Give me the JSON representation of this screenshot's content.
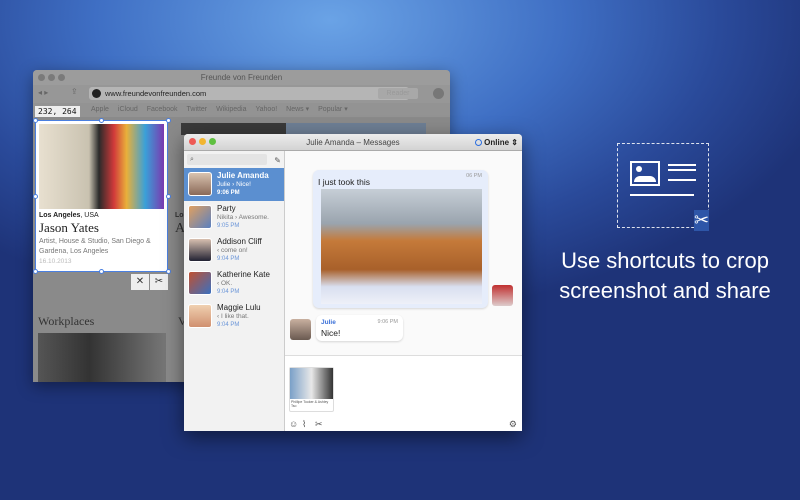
{
  "browser": {
    "title": "Freunde von Freunden",
    "url": "www.freundevonfreunden.com",
    "reader_label": "Reader",
    "bookmarks": [
      "Apple",
      "iCloud",
      "Facebook",
      "Twitter",
      "Wikipedia",
      "Yahoo!",
      "News ▾",
      "Popular ▾"
    ]
  },
  "capture": {
    "coordinates": "232, 264",
    "card": {
      "location_bold": "Los Angeles",
      "location_rest": ", USA",
      "name": "Jason Yates",
      "description": "Artist, House & Studio, San Diego & Gardena, Los Angeles",
      "date": "16.10.2013"
    },
    "close_label": "✕",
    "share_label": "✂"
  },
  "page": {
    "section_heading": "Workplaces",
    "next_heading": "V",
    "partial_label": "Lo",
    "partial_letter": "A"
  },
  "messages": {
    "title": "Julie Amanda – Messages",
    "status": "Online",
    "conversations": [
      {
        "name": "Julie Amanda",
        "preview": "Julie › Nice!",
        "time": "9:06 PM"
      },
      {
        "name": "Party",
        "preview": "Nikita › Awesome.",
        "time": "9:05 PM"
      },
      {
        "name": "Addison Cliff",
        "preview": "‹ come on!",
        "time": "9:04 PM"
      },
      {
        "name": "Katherine Kate",
        "preview": "‹ OK.",
        "time": "9:04 PM"
      },
      {
        "name": "Maggie Lulu",
        "preview": "‹ I like that.",
        "time": "9:04 PM"
      }
    ],
    "chat": [
      {
        "text": "I just took this",
        "time": "06 PM"
      },
      {
        "sender": "Julie",
        "text": "Nice!",
        "time": "9:06 PM"
      }
    ],
    "attachment_caption": "Phillipe Tooker & Ashley Tso"
  },
  "promo": {
    "line1": "Use shortcuts to crop",
    "line2": "screenshot and share"
  }
}
